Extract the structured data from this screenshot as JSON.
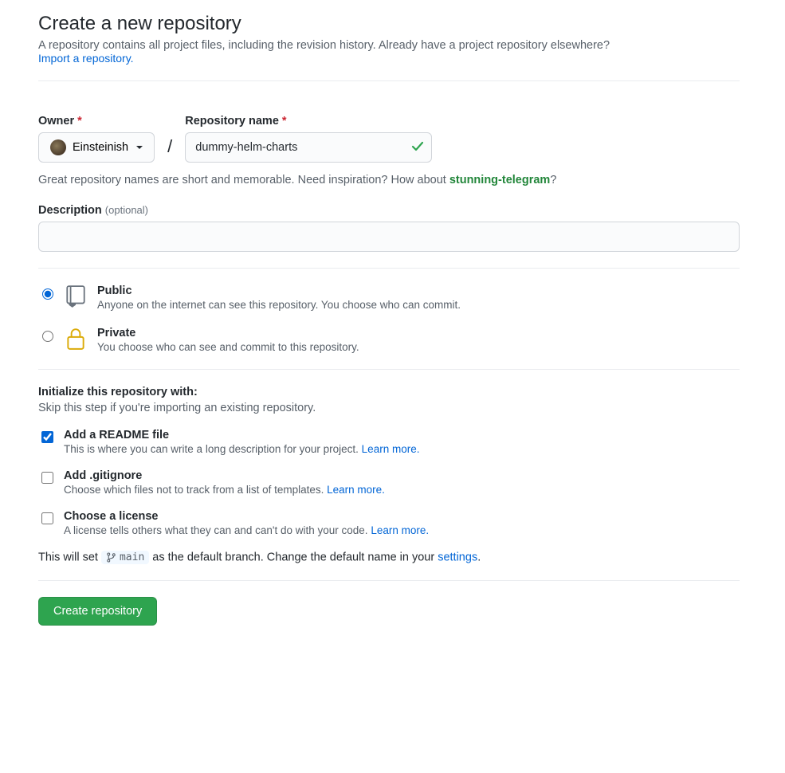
{
  "header": {
    "title": "Create a new repository",
    "subtitle_a": "A repository contains all project files, including the revision history. Already have a project repository elsewhere?",
    "import_link": "Import a repository."
  },
  "owner": {
    "label": "Owner",
    "name": "Einsteinish"
  },
  "repo": {
    "label": "Repository name",
    "value": "dummy-helm-charts"
  },
  "hint": {
    "pre": "Great repository names are short and memorable. Need inspiration? How about ",
    "suggestion": "stunning-telegram",
    "post": "?"
  },
  "description": {
    "label": "Description",
    "optional": "(optional)",
    "value": ""
  },
  "visibility": {
    "public": {
      "title": "Public",
      "sub": "Anyone on the internet can see this repository. You choose who can commit."
    },
    "private": {
      "title": "Private",
      "sub": "You choose who can see and commit to this repository."
    }
  },
  "init": {
    "heading": "Initialize this repository with:",
    "subheading": "Skip this step if you're importing an existing repository.",
    "readme": {
      "title": "Add a README file",
      "sub": "This is where you can write a long description for your project. ",
      "learn": "Learn more."
    },
    "gitignore": {
      "title": "Add .gitignore",
      "sub": "Choose which files not to track from a list of templates. ",
      "learn": "Learn more."
    },
    "license": {
      "title": "Choose a license",
      "sub": "A license tells others what they can and can't do with your code. ",
      "learn": "Learn more."
    }
  },
  "branch": {
    "pre": "This will set ",
    "name": "main",
    "mid": " as the default branch. Change the default name in your ",
    "settings": "settings",
    "post": "."
  },
  "submit": {
    "label": "Create repository"
  }
}
